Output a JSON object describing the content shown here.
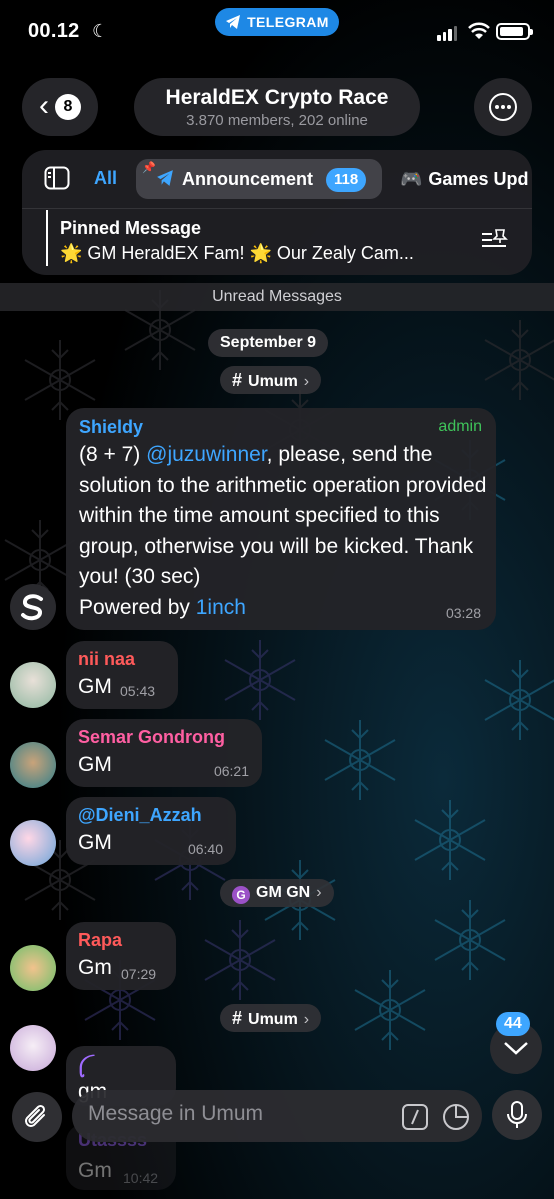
{
  "status_bar": {
    "time": "00.12",
    "app_pill": "TELEGRAM"
  },
  "header": {
    "back_count": "8",
    "title": "HeraldEX Crypto Race",
    "subtitle": "3.870 members, 202 online"
  },
  "topics": {
    "all_label": "All",
    "tabs": [
      {
        "label": "Announcement",
        "badge": "118"
      },
      {
        "label": "Games Upd",
        "badge": ""
      }
    ]
  },
  "pinned": {
    "title": "Pinned Message",
    "text": "🌟 GM HeraldEX Fam! 🌟 Our Zealy Cam..."
  },
  "unread_label": "Unread Messages",
  "date_label": "September 9",
  "topic_pills": {
    "first": "Umum",
    "gm": "GM GN",
    "second": "Umum"
  },
  "messages": [
    {
      "sender": "Shieldy",
      "sender_color": "#3ea6ff",
      "tag": "admin",
      "text_pre": "(8 + 7) ",
      "mention": "@juzuwinner",
      "text_post": ", please, send the solution to the arithmetic operation provided within the time amount specified to this group, otherwise you will be kicked. Thank you! (30 sec)",
      "powered_pre": "Powered by ",
      "powered_link": "1inch",
      "time": "03:28"
    },
    {
      "sender": "nii naa",
      "sender_color": "#ff5a5a",
      "text": "GM",
      "time": "05:43"
    },
    {
      "sender": "Semar Gondrong",
      "sender_color": "#ff5fa2",
      "text": "GM",
      "time": "06:21"
    },
    {
      "sender": "@Dieni_Azzah",
      "sender_color": "#3ea6ff",
      "text": "GM",
      "time": "06:40"
    },
    {
      "sender": "Rapa",
      "sender_color": "#ff5a5a",
      "text": "Gm",
      "time": "07:29"
    },
    {
      "sender": "ꪶ",
      "sender_color": "#a06bff",
      "text": "gm",
      "time": ""
    },
    {
      "sender": "Utassss",
      "sender_color": "#a06bff",
      "text": "Gm",
      "time": "10:42"
    }
  ],
  "scroll_badge": "44",
  "composer": {
    "placeholder": "Message in Umum"
  },
  "colors": {
    "accent": "#3ea6ff",
    "admin": "#3fc35a",
    "bubble": "#242428"
  }
}
